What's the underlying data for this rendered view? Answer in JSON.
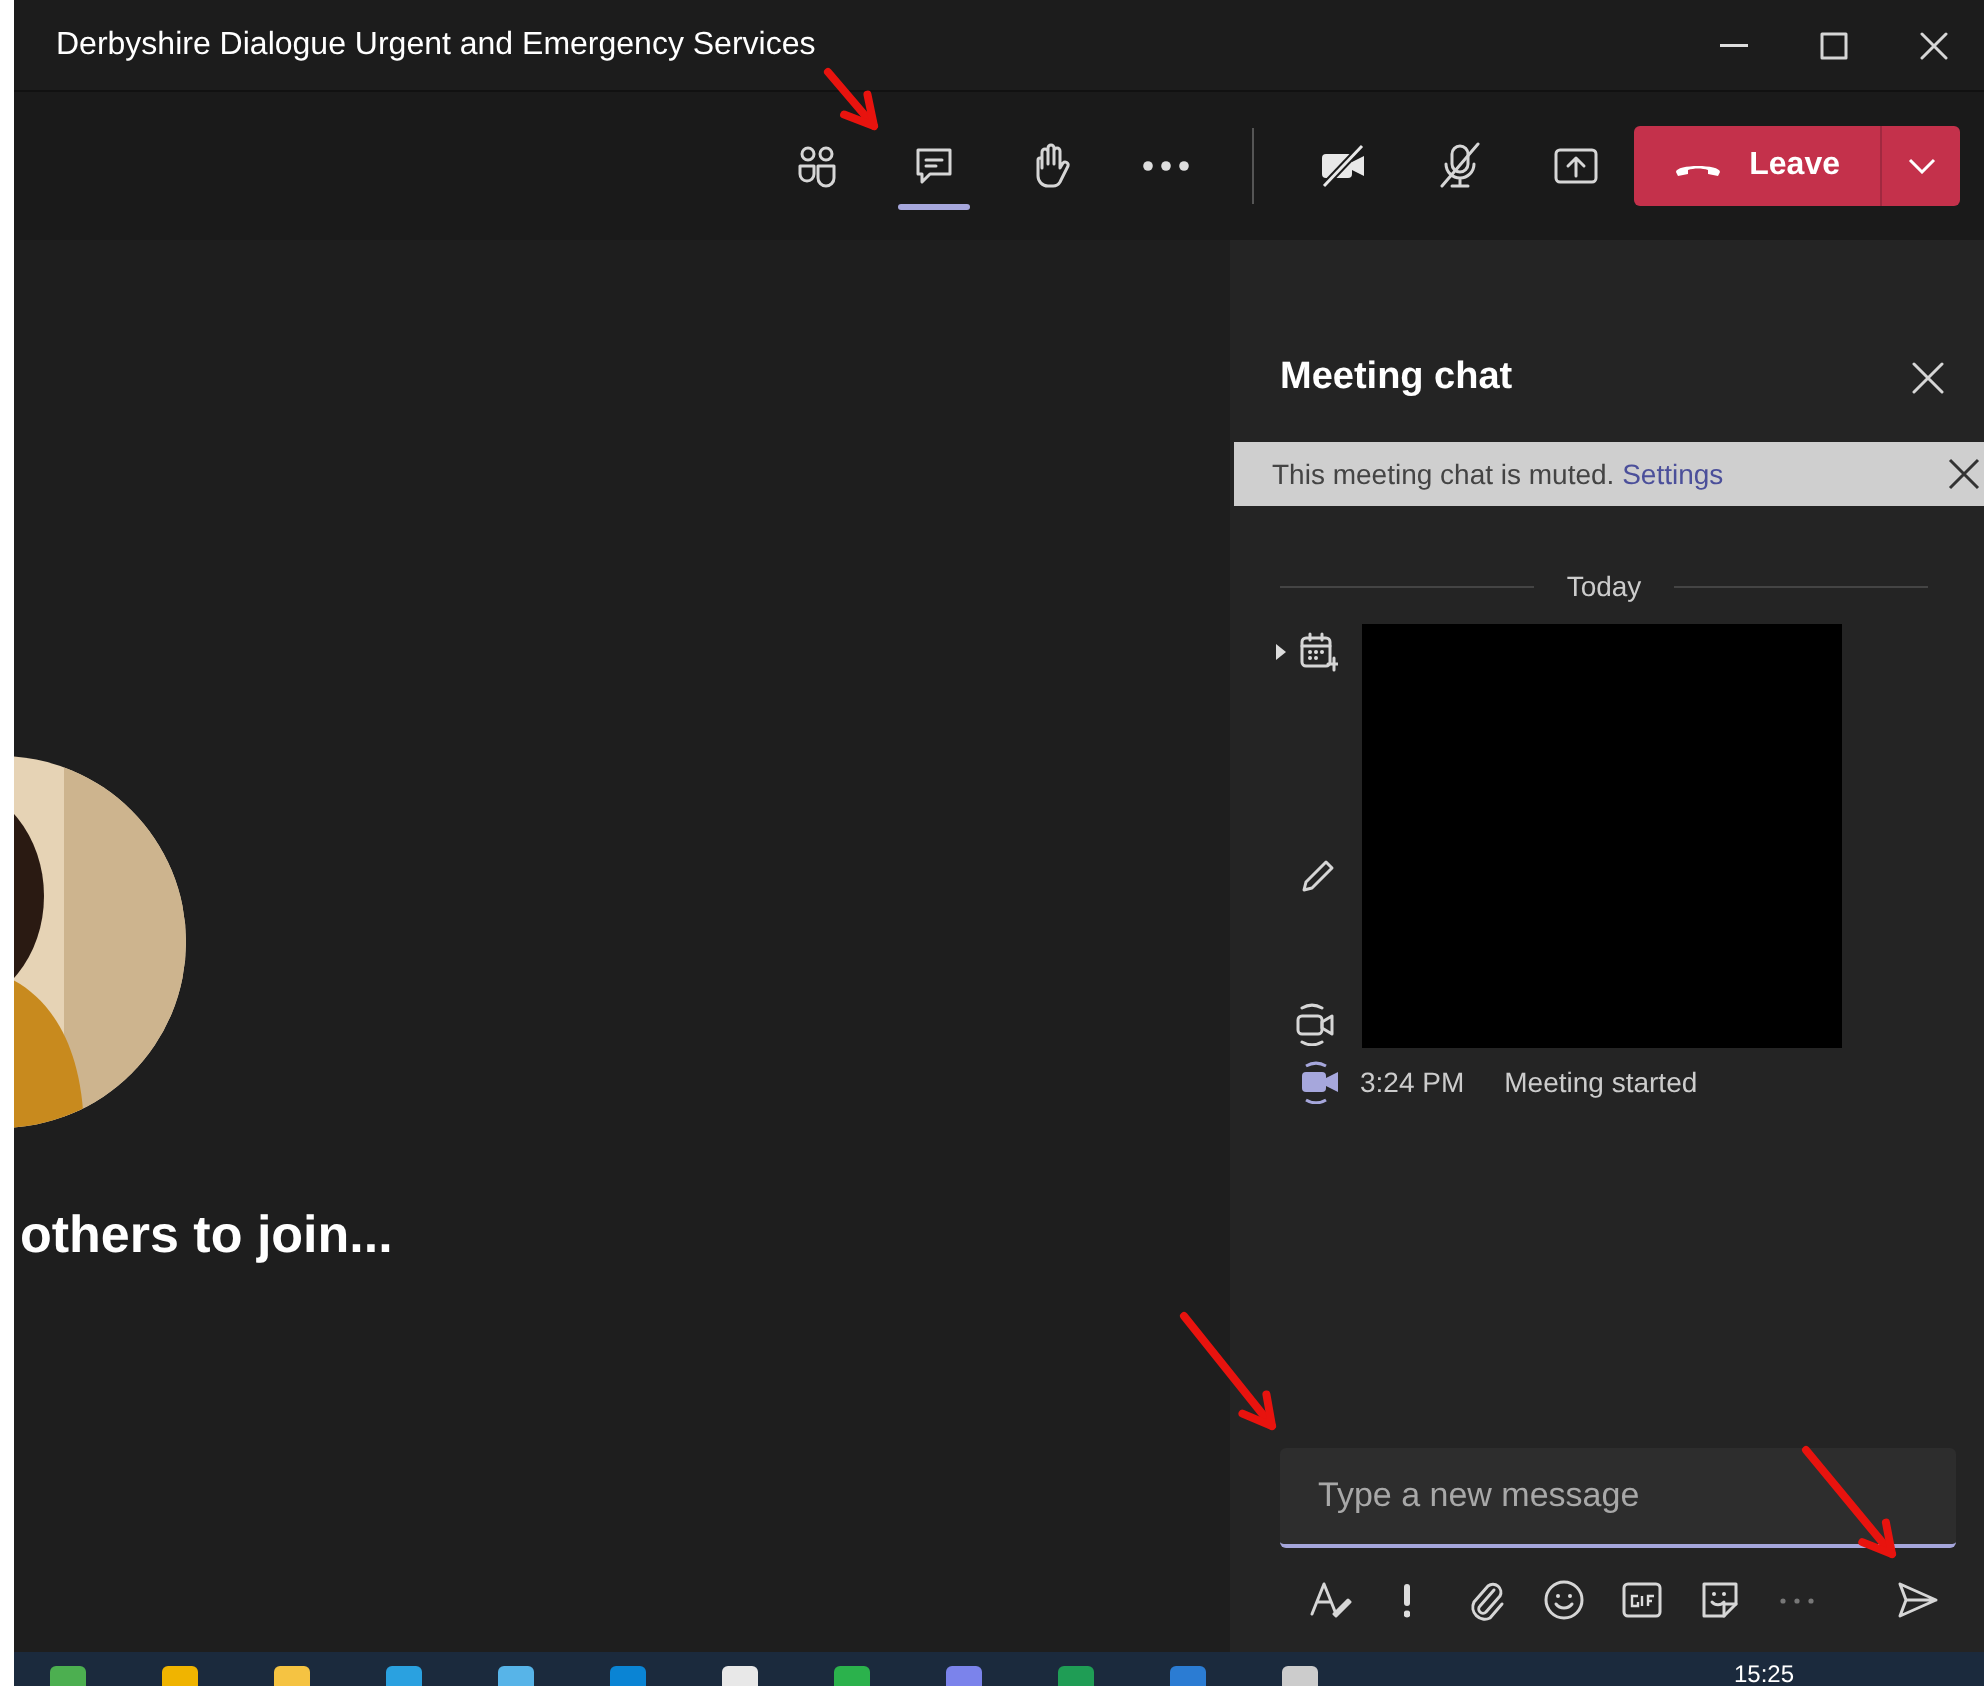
{
  "window": {
    "title": "Derbyshire Dialogue Urgent and Emergency Services"
  },
  "toolbar": {
    "items": [
      {
        "kind": "people",
        "selected": false
      },
      {
        "kind": "chat",
        "selected": true
      },
      {
        "kind": "raise-hand",
        "selected": false
      },
      {
        "kind": "more",
        "selected": false
      }
    ],
    "leave_button": "Leave"
  },
  "stage": {
    "waiting_text": "others to join..."
  },
  "chat": {
    "title": "Meeting chat",
    "banner": {
      "text": "This meeting chat is muted.",
      "link": "Settings"
    },
    "date_divider": "Today",
    "events": [
      {
        "time": "3:24 PM",
        "text": "Meeting started"
      }
    ],
    "compose": {
      "placeholder": "Type a new message"
    }
  },
  "taskbar": {
    "clock": "15:25"
  }
}
